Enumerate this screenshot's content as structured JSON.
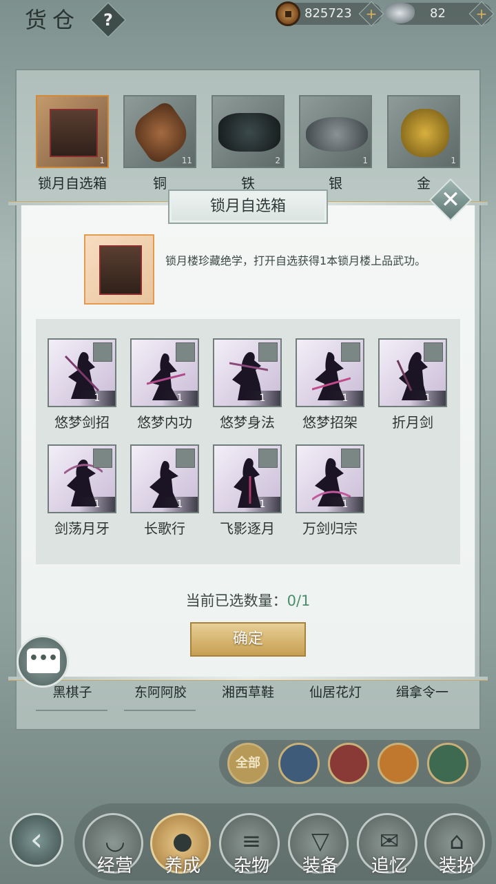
{
  "header": {
    "title": "货仓",
    "help_label": "?"
  },
  "currency": {
    "copper": "825723",
    "silver": "82",
    "plus_label": "+"
  },
  "inventory_items": [
    {
      "name": "锁月自选箱",
      "count": "1"
    },
    {
      "name": "铜",
      "count": "11"
    },
    {
      "name": "铁",
      "count": "2"
    },
    {
      "name": "银",
      "count": "1"
    },
    {
      "name": "金",
      "count": "1"
    }
  ],
  "bottom_items": [
    "黑棋子",
    "东阿阿胶",
    "湘西草鞋",
    "仙居花灯",
    "缉拿令一"
  ],
  "categories": [
    {
      "label": "全部",
      "icon": "all-icon"
    },
    {
      "label": "",
      "icon": "bag-icon"
    },
    {
      "label": "",
      "icon": "tools-icon"
    },
    {
      "label": "",
      "icon": "scrolls-icon"
    },
    {
      "label": "",
      "icon": "umbrella-icon"
    }
  ],
  "nav": {
    "back_label": "‹",
    "tabs": [
      "经营",
      "养成",
      "杂物",
      "装备",
      "追忆",
      "装扮"
    ]
  },
  "modal": {
    "title": "锁月自选箱",
    "close_label": "✕",
    "description": "锁月楼珍藏绝学，打开自选获得1本锁月楼上品武功。",
    "skills": [
      {
        "name": "悠梦剑招",
        "count": "1"
      },
      {
        "name": "悠梦内功",
        "count": "1"
      },
      {
        "name": "悠梦身法",
        "count": "1"
      },
      {
        "name": "悠梦招架",
        "count": "1"
      },
      {
        "name": "折月剑",
        "count": "1"
      },
      {
        "name": "剑荡月牙",
        "count": "1"
      },
      {
        "name": "长歌行",
        "count": "1"
      },
      {
        "name": "飞影逐月",
        "count": "1"
      },
      {
        "name": "万剑归宗",
        "count": "1"
      }
    ],
    "selected_label": "当前已选数量：",
    "selected_value": "0/1",
    "confirm_label": "确定"
  },
  "chat": {
    "icon": "chat-icon",
    "label": "•••"
  }
}
